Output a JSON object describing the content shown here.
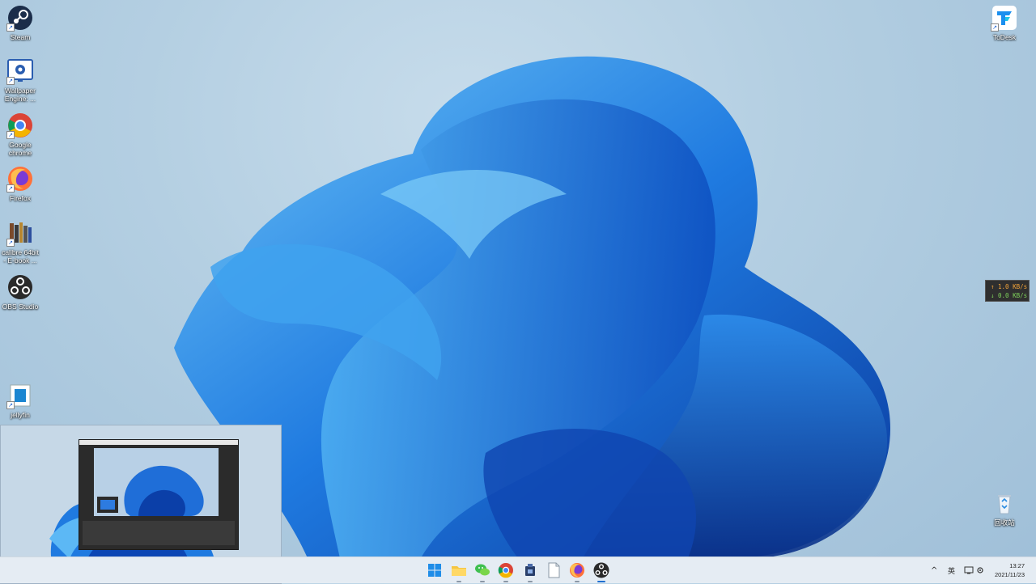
{
  "desktop_icons": [
    {
      "label": "Steam",
      "icon": "steam-icon"
    },
    {
      "label": "Wallpaper Engine: ...",
      "icon": "wallpaper-engine-icon"
    },
    {
      "label": "Google chrome",
      "icon": "chrome-icon"
    },
    {
      "label": "Firefox",
      "icon": "firefox-icon"
    },
    {
      "label": "calibre 64bit - E-book ...",
      "icon": "calibre-icon"
    },
    {
      "label": "OBS Studio",
      "icon": "obs-icon"
    },
    {
      "label": "jellyfin",
      "icon": "jellyfin-icon"
    },
    {
      "label": "ToDesk",
      "icon": "todesk-icon"
    },
    {
      "label": "回收站",
      "icon": "recycle-bin-icon"
    }
  ],
  "net_monitor": {
    "upload": "↑ 1.0 KB/s",
    "download": "↓ 0.0 KB/s"
  },
  "taskbar": {
    "apps": [
      {
        "name": "start",
        "icon": "windows-start-icon"
      },
      {
        "name": "file-explorer",
        "icon": "folder-icon"
      },
      {
        "name": "wechat",
        "icon": "wechat-icon"
      },
      {
        "name": "chrome",
        "icon": "chrome-icon"
      },
      {
        "name": "app",
        "icon": "app-icon"
      },
      {
        "name": "notepad",
        "icon": "document-icon"
      },
      {
        "name": "firefox",
        "icon": "firefox-icon"
      },
      {
        "name": "obs",
        "icon": "obs-icon"
      }
    ],
    "tray": {
      "chevron": "^",
      "ime": "英",
      "time": "13:27",
      "date": "2021/11/23"
    }
  },
  "colors": {
    "accent": "#1f6fd0",
    "taskbar_bg": "#e5ecf3",
    "bloom_dark": "#0b3fa8",
    "bloom_light": "#5cb8f5"
  }
}
